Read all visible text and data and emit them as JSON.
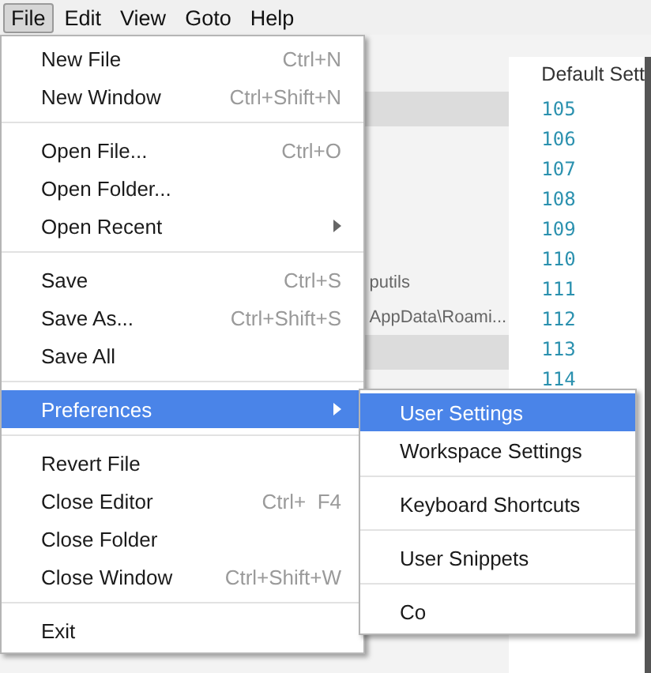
{
  "menubar": [
    {
      "label": "File",
      "selected": true
    },
    {
      "label": "Edit",
      "selected": false
    },
    {
      "label": "View",
      "selected": false
    },
    {
      "label": "Goto",
      "selected": false
    },
    {
      "label": "Help",
      "selected": false
    }
  ],
  "sidebar": {
    "rows": [
      {
        "kind": "blank"
      },
      {
        "kind": "highlight"
      },
      {
        "kind": "blank"
      },
      {
        "kind": "blank"
      },
      {
        "kind": "blank"
      },
      {
        "kind": "blank"
      },
      {
        "kind": "entry",
        "label": "putils"
      },
      {
        "kind": "entry",
        "label": "AppData\\Roami..."
      },
      {
        "kind": "highlight"
      }
    ]
  },
  "editor": {
    "tab_title": "Default Sett",
    "line_numbers": [
      "105",
      "106",
      "107",
      "108",
      "109",
      "110",
      "111",
      "112",
      "113",
      "114"
    ]
  },
  "file_menu": [
    {
      "kind": "item",
      "label": "New File",
      "shortcut": "Ctrl+N",
      "selected": false
    },
    {
      "kind": "item",
      "label": "New Window",
      "shortcut": "Ctrl+Shift+N",
      "selected": false
    },
    {
      "kind": "separator"
    },
    {
      "kind": "item",
      "label": "Open File...",
      "shortcut": "Ctrl+O",
      "selected": false
    },
    {
      "kind": "item",
      "label": "Open Folder...",
      "selected": false
    },
    {
      "kind": "submenu",
      "label": "Open Recent",
      "selected": false
    },
    {
      "kind": "separator"
    },
    {
      "kind": "item",
      "label": "Save",
      "shortcut": "Ctrl+S",
      "selected": false
    },
    {
      "kind": "item",
      "label": "Save As...",
      "shortcut": "Ctrl+Shift+S",
      "selected": false
    },
    {
      "kind": "item",
      "label": "Save All",
      "selected": false
    },
    {
      "kind": "separator"
    },
    {
      "kind": "submenu",
      "label": "Preferences",
      "selected": true
    },
    {
      "kind": "separator"
    },
    {
      "kind": "item",
      "label": "Revert File",
      "selected": false
    },
    {
      "kind": "item",
      "label": "Close Editor",
      "shortcut": "Ctrl+  F4",
      "selected": false
    },
    {
      "kind": "item",
      "label": "Close Folder",
      "selected": false
    },
    {
      "kind": "item",
      "label": "Close Window",
      "shortcut": "Ctrl+Shift+W",
      "selected": false
    },
    {
      "kind": "separator"
    },
    {
      "kind": "item",
      "label": "Exit",
      "selected": false
    }
  ],
  "preferences_menu": [
    {
      "kind": "item",
      "label": "User Settings",
      "selected": true
    },
    {
      "kind": "item",
      "label": "Workspace Settings",
      "selected": false
    },
    {
      "kind": "separator"
    },
    {
      "kind": "item",
      "label": "Keyboard Shortcuts",
      "selected": false
    },
    {
      "kind": "separator"
    },
    {
      "kind": "item",
      "label": "User Snippets",
      "selected": false
    },
    {
      "kind": "separator"
    },
    {
      "kind": "item",
      "label": "Co",
      "selected": false
    }
  ]
}
